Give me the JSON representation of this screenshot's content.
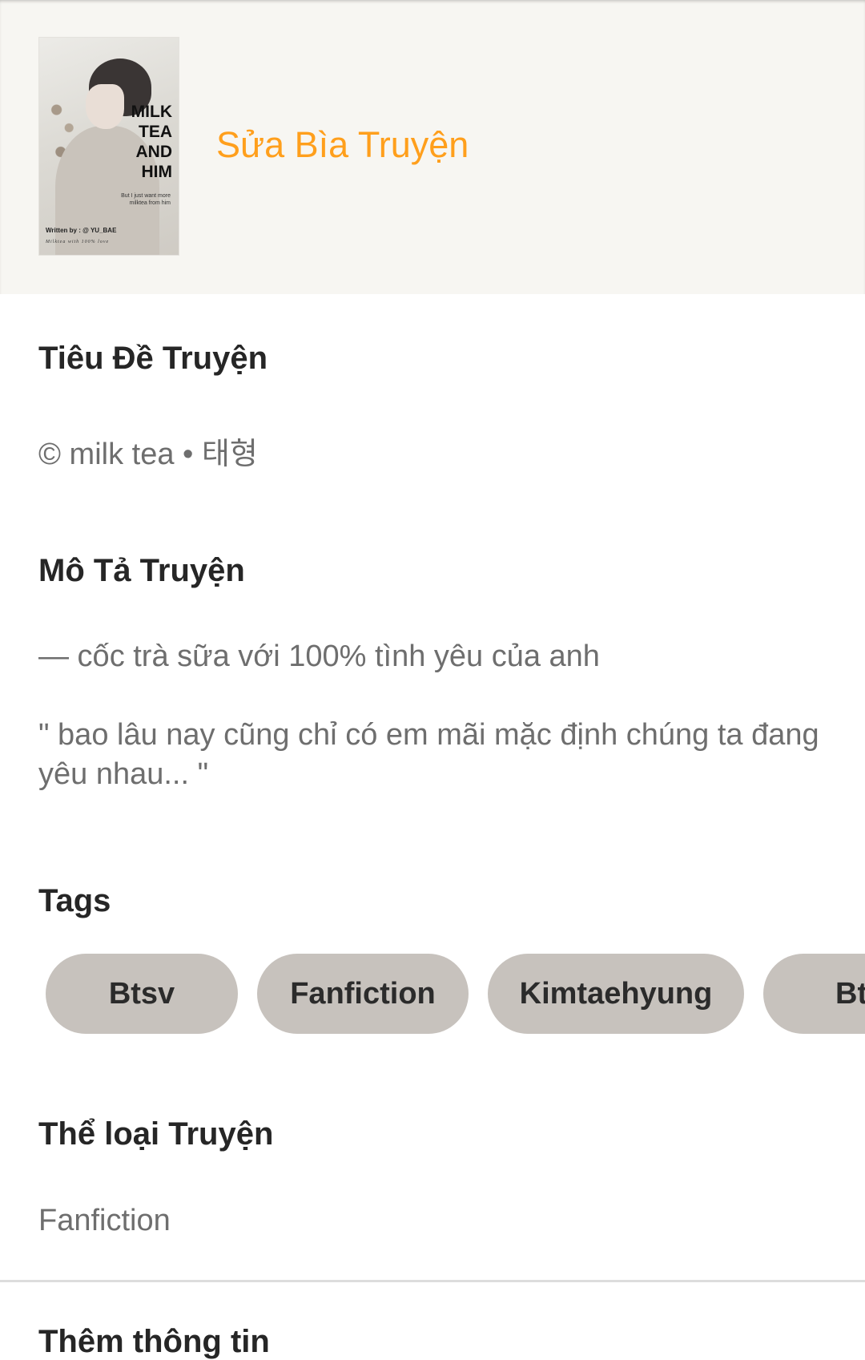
{
  "header": {
    "edit_cover_label": "Sửa Bìa Truyện",
    "cover": {
      "title_text": "MILK\nTEA\nAND\nHIM",
      "subtitle_text": "But I just want more\nmilktea from him",
      "author_text": "Written by : @ YU_BAE",
      "footer_text": "Milktea with 100% love"
    }
  },
  "story_title": {
    "heading": "Tiêu Đề Truyện",
    "value": "© milk tea • 태형"
  },
  "story_description": {
    "heading": "Mô Tả Truyện",
    "line1": "— cốc trà sữa với 100% tình yêu của anh",
    "line2": "\" bao lâu nay cũng chỉ có em mãi mặc định chúng ta đang yêu nhau... \""
  },
  "tags": {
    "heading": "Tags",
    "items": [
      "Btsv",
      "Fanfiction",
      "Kimtaehyung",
      "Bt"
    ]
  },
  "genre": {
    "heading": "Thể loại Truyện",
    "value": "Fanfiction"
  },
  "more_info": {
    "heading": "Thêm thông tin"
  },
  "colors": {
    "accent": "#ff9f1c",
    "header_bg": "#f7f6f2",
    "tag_bg": "#c7c2bd"
  }
}
